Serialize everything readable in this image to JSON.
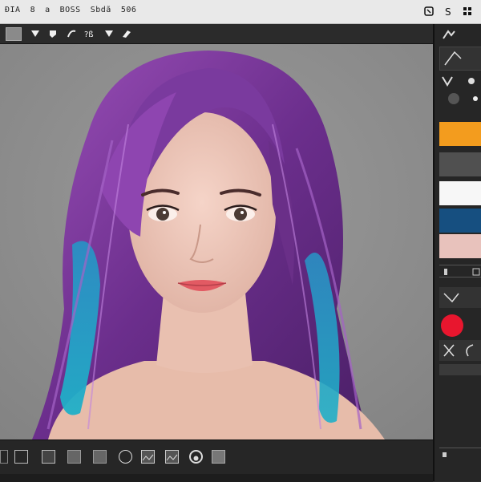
{
  "menubar": {
    "items": [
      "ĐIA",
      "8",
      "a",
      "BOSS",
      "Sbdã",
      "506"
    ],
    "right_icons": [
      "layers-icon",
      "settings-icon",
      "grid-icon"
    ]
  },
  "toolbar": {
    "tools": [
      "marquee-tool",
      "move-tool",
      "brush-tool",
      "lasso-tool",
      "eyedropper-tool",
      "fill-tool",
      "pen-tool"
    ]
  },
  "panel": {
    "header_icon": "pin-icon",
    "swatches": [
      "#f39c1e",
      "#505050",
      "#f7f7f7",
      "#164f80",
      "#e8c2bc"
    ],
    "foreground_color": "#e8162e"
  },
  "canvas": {
    "background": "#8e8e8e",
    "content": "portrait"
  },
  "bottombar": {
    "tools": [
      "rectangle-tool",
      "rectangle-outline-tool",
      "square-fill-tool",
      "square-tool",
      "circle-tool",
      "image-tool",
      "image-alt-tool",
      "radio-tool",
      "square-small-tool"
    ]
  }
}
